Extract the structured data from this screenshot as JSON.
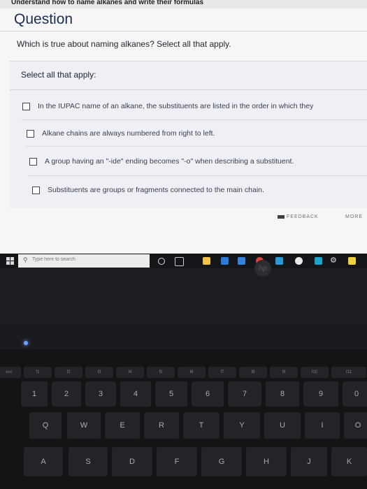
{
  "page": {
    "header": "Understand how to name alkanes and write their formulas",
    "title": "Question",
    "prompt": "Which is true about naming alkanes? Select all that apply."
  },
  "panel": {
    "select_label": "Select all that apply:",
    "options": [
      {
        "label": "In the IUPAC name of an alkane, the substituents are listed in the order in which they",
        "checked": false
      },
      {
        "label": "Alkane chains are always numbered from right to left.",
        "checked": false
      },
      {
        "label": "A group having an \"-ide\" ending becomes \"-o\" when describing a substituent.",
        "checked": false
      },
      {
        "label": "Substituents are groups or fragments connected to the main chain.",
        "checked": false
      }
    ]
  },
  "footer": {
    "feedback_label": "FEEDBACK",
    "more_label": "MORE"
  },
  "taskbar": {
    "search_placeholder": "Type here to search",
    "apps": [
      "cortana-icon",
      "task-view-icon",
      "file-explorer-icon",
      "edge-icon",
      "store-icon",
      "chrome-icon",
      "app-icon",
      "app-icon",
      "settings-icon",
      "sticky-notes-icon"
    ]
  },
  "keyboard": {
    "function_row": [
      "esc",
      "f1",
      "f2",
      "f3",
      "f4",
      "f5",
      "f6",
      "f7",
      "f8",
      "f9",
      "f10",
      "f11"
    ],
    "number_row": [
      {
        "upper": "",
        "lower": "1"
      },
      {
        "upper": "@",
        "lower": "2"
      },
      {
        "upper": "#",
        "lower": "3"
      },
      {
        "upper": "$",
        "lower": "4"
      },
      {
        "upper": "%",
        "lower": "5"
      },
      {
        "upper": "^",
        "lower": "6"
      },
      {
        "upper": "&",
        "lower": "7"
      },
      {
        "upper": "",
        "lower": "8"
      },
      {
        "upper": "(",
        "lower": "9"
      },
      {
        "upper": ")",
        "lower": "0"
      }
    ],
    "top_letter_row": [
      "Q",
      "W",
      "E",
      "R",
      "T",
      "Y",
      "U",
      "I",
      "O"
    ],
    "home_row": [
      "A",
      "S",
      "D",
      "F",
      "G",
      "H",
      "J",
      "K"
    ],
    "brand": "hp"
  }
}
